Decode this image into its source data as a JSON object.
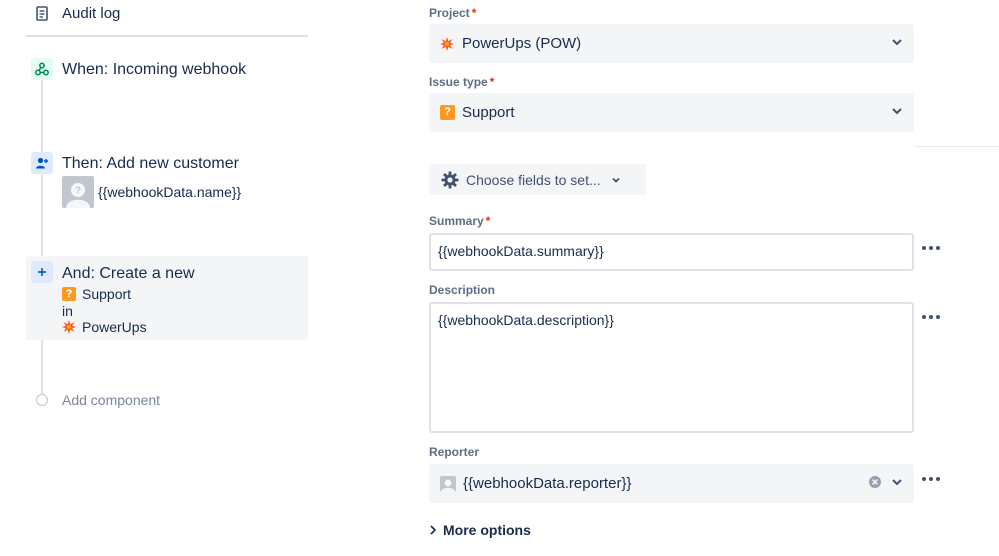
{
  "sidebar": {
    "audit_log": "Audit log",
    "components": [
      {
        "prefix": "When:",
        "title": "When: Incoming webhook",
        "icon": "webhook-icon"
      },
      {
        "title": "Then: Add new customer",
        "icon": "add-person-icon",
        "detail": "{{webhookData.name}}"
      },
      {
        "title": "And: Create a new",
        "icon": "plus-icon",
        "issue_type": "Support",
        "in_label": "in",
        "project": "PowerUps"
      }
    ],
    "add_component": "Add component"
  },
  "form": {
    "project": {
      "label": "Project",
      "required_mark": "*",
      "value": "PowerUps (POW)"
    },
    "issue_type": {
      "label": "Issue type",
      "required_mark": "*",
      "value": "Support"
    },
    "choose_fields": "Choose fields to set...",
    "summary": {
      "label": "Summary",
      "required_mark": "*",
      "value": "{{webhookData.summary}}"
    },
    "description": {
      "label": "Description",
      "value": "{{webhookData.description}}"
    },
    "reporter": {
      "label": "Reporter",
      "value": "{{webhookData.reporter}}"
    },
    "more_options": "More options"
  },
  "colors": {
    "text": "#172b4d",
    "subtle": "#5e6c84",
    "required": "#de350b",
    "field_bg": "#f4f5f7",
    "border": "#dfe1e6",
    "issue_support": "#ff991f",
    "project_icon": "#ff5630"
  }
}
